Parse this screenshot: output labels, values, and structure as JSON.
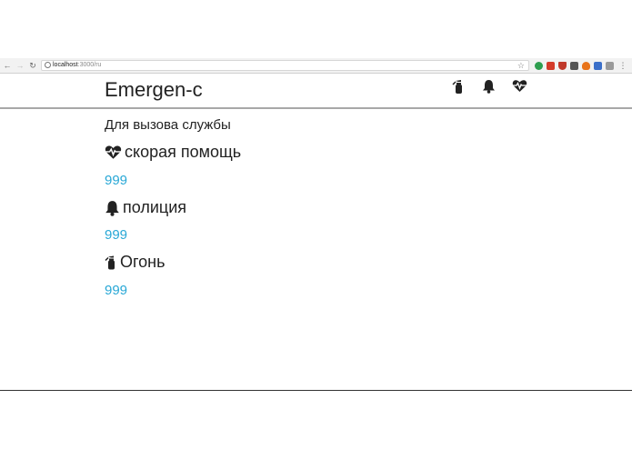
{
  "browser": {
    "url_host": "localhost",
    "url_path": ":3000/ru"
  },
  "navbar": {
    "brand": "Emergen-c",
    "icons": [
      "fire-extinguisher-icon",
      "bell-icon",
      "heartbeat-icon"
    ]
  },
  "main": {
    "subtitle": "Для вызова службы",
    "services": [
      {
        "icon": "heartbeat-icon",
        "title": "скорая помощь",
        "phone": "999"
      },
      {
        "icon": "bell-icon",
        "title": "полиция",
        "phone": "999"
      },
      {
        "icon": "fire-extinguisher-icon",
        "title": "Огонь",
        "phone": "999"
      }
    ]
  },
  "colors": {
    "link": "#29a8d6",
    "text": "#222222",
    "navbar_border": "#a8a8a8"
  }
}
